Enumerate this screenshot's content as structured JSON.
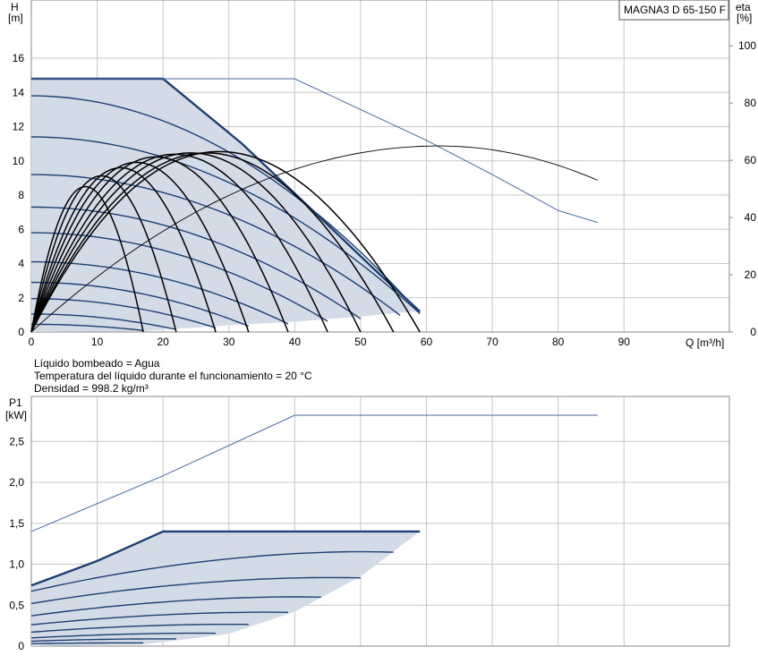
{
  "model_label": "MAGNA3 D 65-150 F",
  "info": [
    "Líquido bombeado = Agua",
    "Temperatura del líquido durante el funcionamiento = 20 °C",
    "Densidad = 998.2 kg/m³"
  ],
  "colors": {
    "grid": "#c8c8c8",
    "fill": "#d3dbe7",
    "curve": "#1f3f73",
    "thin": "#4a6a9a",
    "eta": "#000000"
  },
  "chart_data": [
    {
      "type": "line",
      "id": "head-flow",
      "ylabel_top": "H",
      "ylabel_unit": "[m]",
      "y2label_top": "eta",
      "y2label_unit": "[%]",
      "xlabel": "Q [m³/h]",
      "xlim": [
        0,
        106
      ],
      "ylim": [
        0,
        19.4
      ],
      "y2lim": [
        0,
        116
      ],
      "xticks": [
        0,
        10,
        20,
        30,
        40,
        50,
        60,
        70,
        80,
        90
      ],
      "yticks": [
        0,
        2,
        4,
        6,
        8,
        10,
        12,
        14,
        16
      ],
      "y2ticks": [
        0,
        20,
        40,
        60,
        80,
        100
      ],
      "grid": true,
      "max_envelope": [
        [
          0,
          14.8
        ],
        [
          20,
          14.8
        ],
        [
          32,
          11
        ],
        [
          43,
          7
        ],
        [
          52,
          3.7
        ],
        [
          59,
          1.2
        ]
      ],
      "duty_area": [
        [
          0,
          0
        ],
        [
          0,
          14.8
        ],
        [
          20,
          14.8
        ],
        [
          32,
          11
        ],
        [
          43,
          7
        ],
        [
          52,
          3.7
        ],
        [
          59,
          1.2
        ],
        [
          55,
          1.1
        ],
        [
          50,
          0.9
        ],
        [
          40,
          0.6
        ],
        [
          30,
          0.4
        ],
        [
          17,
          0.05
        ]
      ],
      "twin_envelope": [
        [
          0,
          14.8
        ],
        [
          40,
          14.8
        ],
        [
          50,
          13
        ],
        [
          60,
          11.2
        ],
        [
          70,
          9.2
        ],
        [
          80,
          7.1
        ],
        [
          86,
          6.4
        ]
      ],
      "speed_curves": [
        {
          "h0": 13.8,
          "qmax": 59
        },
        {
          "h0": 11.4,
          "qmax": 59
        },
        {
          "h0": 9.2,
          "qmax": 56
        },
        {
          "h0": 7.3,
          "qmax": 50
        },
        {
          "h0": 5.8,
          "qmax": 45
        },
        {
          "h0": 4.1,
          "qmax": 39
        },
        {
          "h0": 2.9,
          "qmax": 33
        },
        {
          "h0": 1.95,
          "qmax": 28
        },
        {
          "h0": 1.05,
          "qmax": 22
        },
        {
          "h0": 0.45,
          "qmax": 17
        }
      ],
      "efficiency_curves": [
        {
          "qmax": 17,
          "peak": 54
        },
        {
          "qmax": 22,
          "peak": 58
        },
        {
          "qmax": 28,
          "peak": 61
        },
        {
          "qmax": 33,
          "peak": 63
        },
        {
          "qmax": 39,
          "peak": 65
        },
        {
          "qmax": 45,
          "peak": 66
        },
        {
          "qmax": 50,
          "peak": 66.5
        },
        {
          "qmax": 55,
          "peak": 66.5
        },
        {
          "qmax": 59,
          "peak": 67
        }
      ],
      "twin_efficiency": {
        "qmax": 86,
        "peak": 65,
        "end": 53
      }
    },
    {
      "type": "line",
      "id": "power-flow",
      "ylabel_top": "P1",
      "ylabel_unit": "[kW]",
      "xlim": [
        0,
        106
      ],
      "ylim": [
        0,
        3.05
      ],
      "xticks": [
        0,
        10,
        20,
        30,
        40,
        50,
        60,
        70,
        80,
        90
      ],
      "yticks": [
        0,
        0.5,
        1.0,
        1.5,
        2.0,
        2.5
      ],
      "ytick_labels": [
        "0",
        "0,5",
        "1,0",
        "1,5",
        "2,0",
        "2,5"
      ],
      "grid": true,
      "max_curve": [
        [
          0,
          0.74
        ],
        [
          10,
          1.04
        ],
        [
          20,
          1.4
        ],
        [
          59,
          1.4
        ]
      ],
      "duty_area": [
        [
          0,
          0
        ],
        [
          0,
          0.74
        ],
        [
          10,
          1.04
        ],
        [
          20,
          1.4
        ],
        [
          59,
          1.4
        ],
        [
          50,
          0.85
        ],
        [
          40,
          0.42
        ],
        [
          30,
          0.15
        ],
        [
          17,
          0.02
        ]
      ],
      "twin_curve": [
        [
          0,
          1.4
        ],
        [
          20,
          2.08
        ],
        [
          40,
          2.82
        ],
        [
          86,
          2.82
        ]
      ],
      "speed_curves": [
        {
          "p0": 0.67,
          "qmax": 55,
          "pmax": 1.17
        },
        {
          "p0": 0.52,
          "qmax": 50,
          "pmax": 0.85
        },
        {
          "p0": 0.37,
          "qmax": 44,
          "pmax": 0.61
        },
        {
          "p0": 0.26,
          "qmax": 39,
          "pmax": 0.42
        },
        {
          "p0": 0.17,
          "qmax": 33,
          "pmax": 0.27
        },
        {
          "p0": 0.1,
          "qmax": 28,
          "pmax": 0.16
        },
        {
          "p0": 0.06,
          "qmax": 22,
          "pmax": 0.09
        },
        {
          "p0": 0.03,
          "qmax": 17,
          "pmax": 0.04
        }
      ]
    }
  ]
}
